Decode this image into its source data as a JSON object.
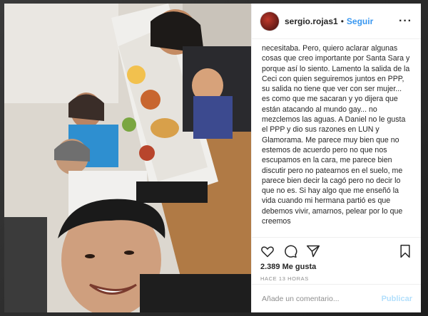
{
  "post": {
    "username": "sergio.rojas1",
    "separator": "•",
    "follow_label": "Seguir",
    "more_label": "···",
    "caption": "necesitaba. Pero, quiero aclarar algunas cosas que creo importante por Santa Sara y porque así lo siento. Lamento la salida de la Ceci con quien seguiremos juntos en PPP, su salida no tiene que ver con ser mujer... es como que me sacaran y yo dijera que están atacando al mundo gay... no mezclemos las aguas. A Daniel no le gusta el PPP y dio sus razones en LUN y Glamorama. Me parece muy bien que no estemos de acuerdo pero no que nos escupamos en la cara, me parece bien discutir pero no patearnos en el suelo, me parece bien decir la cagó pero no decir lo que no es. Si hay algo que me enseñó la vida cuando mi hermana partió es que debemos vivir, amarnos, pelear por lo que creemos",
    "likes": "2.389 Me gusta",
    "time": "HACE 13 HORAS",
    "comment_placeholder": "Añade un comentario...",
    "publish_label": "Publicar"
  },
  "icons": [
    "heart-icon",
    "comment-icon",
    "share-icon",
    "bookmark-icon"
  ]
}
